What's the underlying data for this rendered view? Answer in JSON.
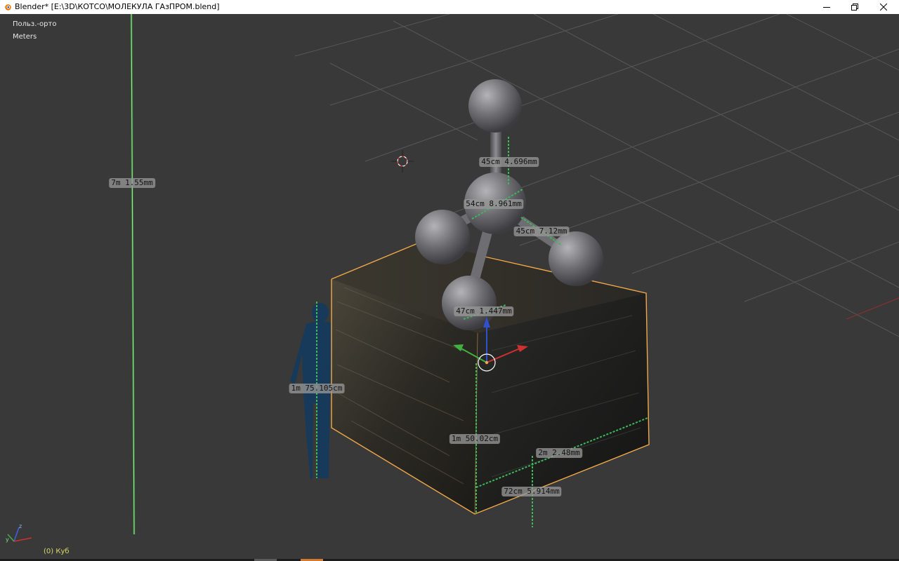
{
  "window": {
    "title": "Blender* [E:\\3D\\КОТСО\\МОЛЕКУЛА ГАзПРОМ.blend]"
  },
  "viewport": {
    "view_name": "Польз.-орто",
    "units": "Meters",
    "active_object": "(0) Куб"
  },
  "measurements": {
    "tall_ruler": "7m 1.55mm",
    "top_bond": "45cm 4.696mm",
    "center_bond": "54cm 8.961mm",
    "right_bond": "45cm 7.12mm",
    "front_bond": "47cm 1.447mm",
    "human_height": "1m 75.105cm",
    "cube_height": "1m 50.02cm",
    "cube_width": "2m 2.48mm",
    "cube_offset": "72cm 5.914mm"
  },
  "colors": {
    "viewport_bg": "#393939",
    "grid_line": "#5a5a5a",
    "selection_outline": "#f0a94a",
    "ruler_green": "#9be39b",
    "human_figure": "#173a5a",
    "active_object_text": "#d9d96b"
  }
}
